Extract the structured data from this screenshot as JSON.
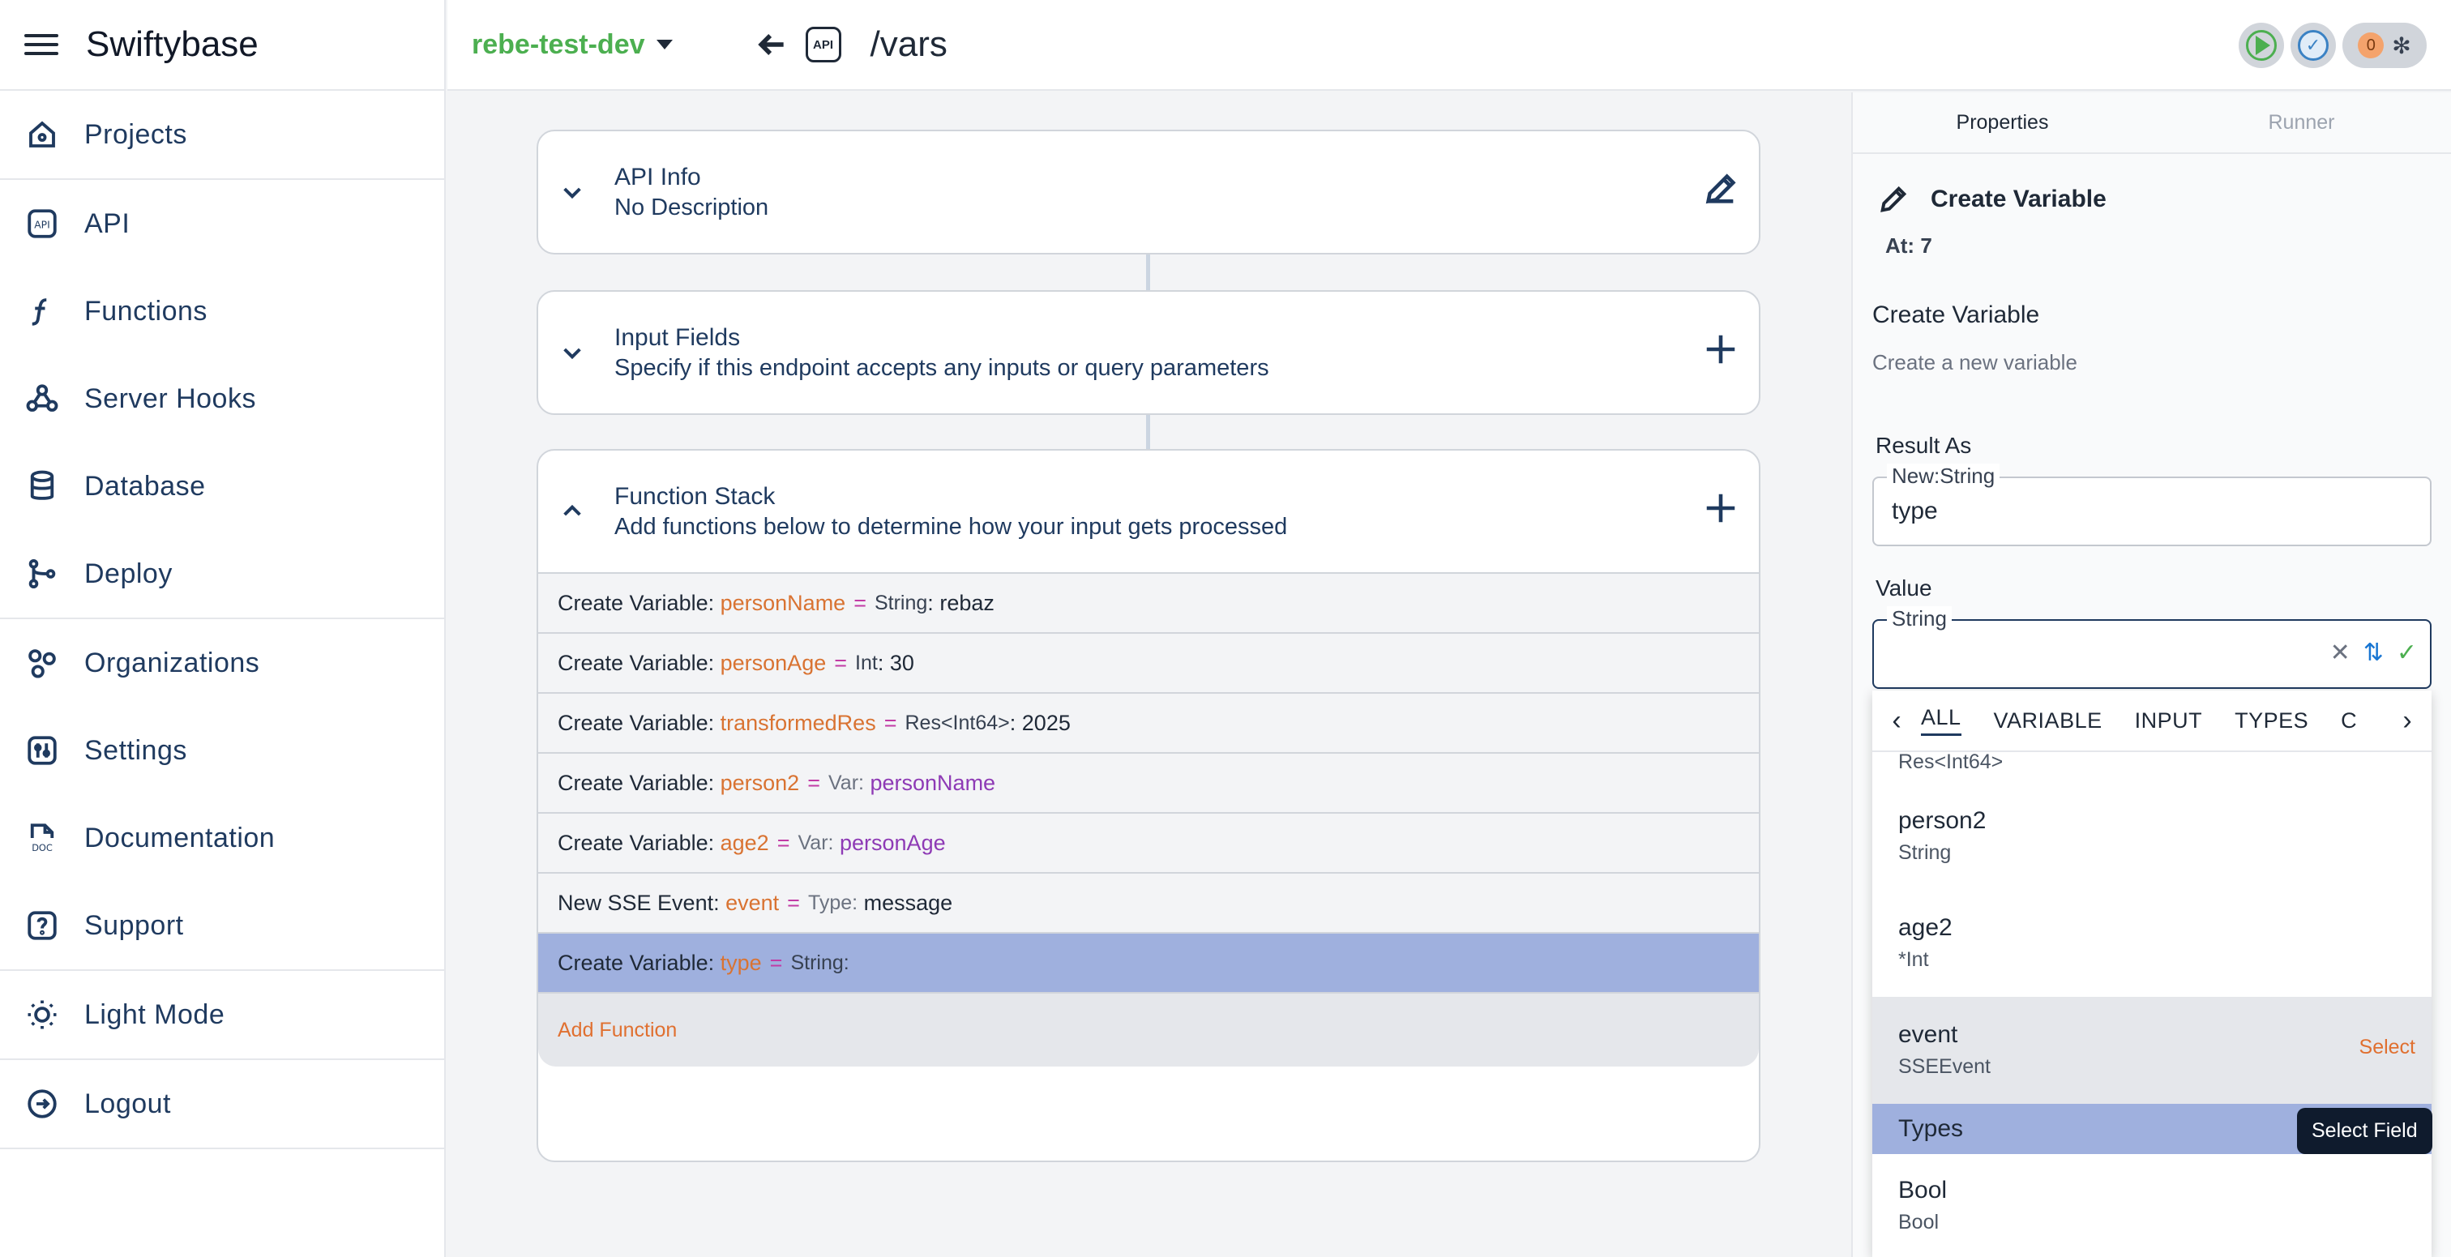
{
  "app": {
    "title": "Swiftybase"
  },
  "sidebar": {
    "items": [
      {
        "label": "Projects",
        "icon": "home-icon"
      },
      {
        "label": "API",
        "icon": "api-icon"
      },
      {
        "label": "Functions",
        "icon": "function-icon"
      },
      {
        "label": "Server Hooks",
        "icon": "webhook-icon"
      },
      {
        "label": "Database",
        "icon": "database-icon"
      },
      {
        "label": "Deploy",
        "icon": "git-branch-icon"
      },
      {
        "label": "Organizations",
        "icon": "organizations-icon"
      },
      {
        "label": "Settings",
        "icon": "settings-icon"
      },
      {
        "label": "Documentation",
        "icon": "doc-icon"
      },
      {
        "label": "Support",
        "icon": "help-icon"
      },
      {
        "label": "Light Mode",
        "icon": "sun-icon"
      },
      {
        "label": "Logout",
        "icon": "logout-icon"
      }
    ]
  },
  "header": {
    "environment": "rebe-test-dev",
    "api_badge": "API",
    "path": "/vars",
    "error_count": "0"
  },
  "cards": {
    "api_info": {
      "title": "API Info",
      "description": "No Description"
    },
    "input_fields": {
      "title": "Input Fields",
      "description": "Specify if this endpoint accepts any inputs or query parameters"
    },
    "function_stack": {
      "title": "Function Stack",
      "description": "Add functions below to determine how your input gets processed"
    }
  },
  "function_stack": {
    "rows": [
      {
        "prefix": "Create Variable:",
        "name": "personName",
        "type": "String",
        "sep": ":",
        "value": "rebaz"
      },
      {
        "prefix": "Create Variable:",
        "name": "personAge",
        "type": "Int",
        "sep": ":",
        "value": "30"
      },
      {
        "prefix": "Create Variable:",
        "name": "transformedRes",
        "type": "Res<Int64>",
        "sep": ":",
        "value": "2025"
      },
      {
        "prefix": "Create Variable:",
        "name": "person2",
        "type": "Var:",
        "sep": "",
        "value": "personName"
      },
      {
        "prefix": "Create Variable:",
        "name": "age2",
        "type": "Var:",
        "sep": "",
        "value": "personAge"
      },
      {
        "prefix": "New SSE Event:",
        "name": "event",
        "type": "Type:",
        "sep": "",
        "value": "message"
      },
      {
        "prefix": "Create Variable:",
        "name": "type",
        "type": "String:",
        "sep": "",
        "value": ""
      }
    ],
    "add_label": "Add Function"
  },
  "panel": {
    "tabs": [
      "Properties",
      "Runner"
    ],
    "header_title": "Create Variable",
    "at": "At: 7",
    "section_title": "Create Variable",
    "section_sub": "Create a new variable",
    "result_label": "Result As",
    "result_legend": "New:String",
    "result_value": "type",
    "value_label": "Value",
    "value_legend": "String",
    "value_value": ""
  },
  "dropdown": {
    "tabs": [
      "ALL",
      "VARIABLE",
      "INPUT",
      "TYPES",
      "C"
    ],
    "partial_type": "Res<Int64>",
    "items": [
      {
        "name": "person2",
        "type": "String"
      },
      {
        "name": "age2",
        "type": "*Int"
      },
      {
        "name": "event",
        "type": "SSEEvent",
        "action": "Select"
      }
    ],
    "group": "Types",
    "group_items": [
      {
        "name": "Bool",
        "type": "Bool"
      }
    ]
  },
  "tooltip": "Select Field"
}
